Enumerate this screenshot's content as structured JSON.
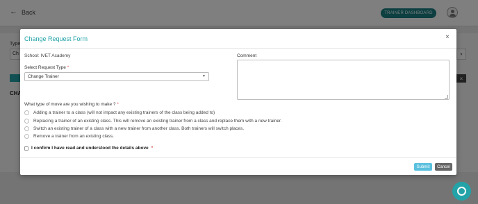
{
  "page": {
    "back_label": "Back",
    "trainer_dashboard_label": "TRAINER DASHBOARD",
    "type_label": "Type",
    "type_value": "Ch",
    "section_heading": "CHA"
  },
  "modal": {
    "title": "Change Request Form",
    "school": "School: IVET Academy",
    "request_type_label": "Select Request Type",
    "request_type_value": "Change Trainer",
    "comment_label": "Comment",
    "move_question": "What type of move are you wishing to make ?",
    "options": [
      "Adding a trainer to a class (will not impact any existing trainers of the class being added to)",
      "Replacing a trainer of an existing class. This will remove an existing trainer from a class and replace them with a new trainer.",
      "Switch an existing trainer of a class with a new trainer from another class. Both trainers will switch places.",
      "Remove a trainer from an existing class."
    ],
    "confirm_label": "I confirm I have read and understood the details above",
    "submit_label": "Submit",
    "cancel_label": "Cancel",
    "required_marker": "*",
    "close_glyph": "×"
  },
  "colors": {
    "accent": "#23a3a8",
    "submit": "#5bc0de",
    "cancel": "#666666",
    "required": "#d9534f"
  }
}
